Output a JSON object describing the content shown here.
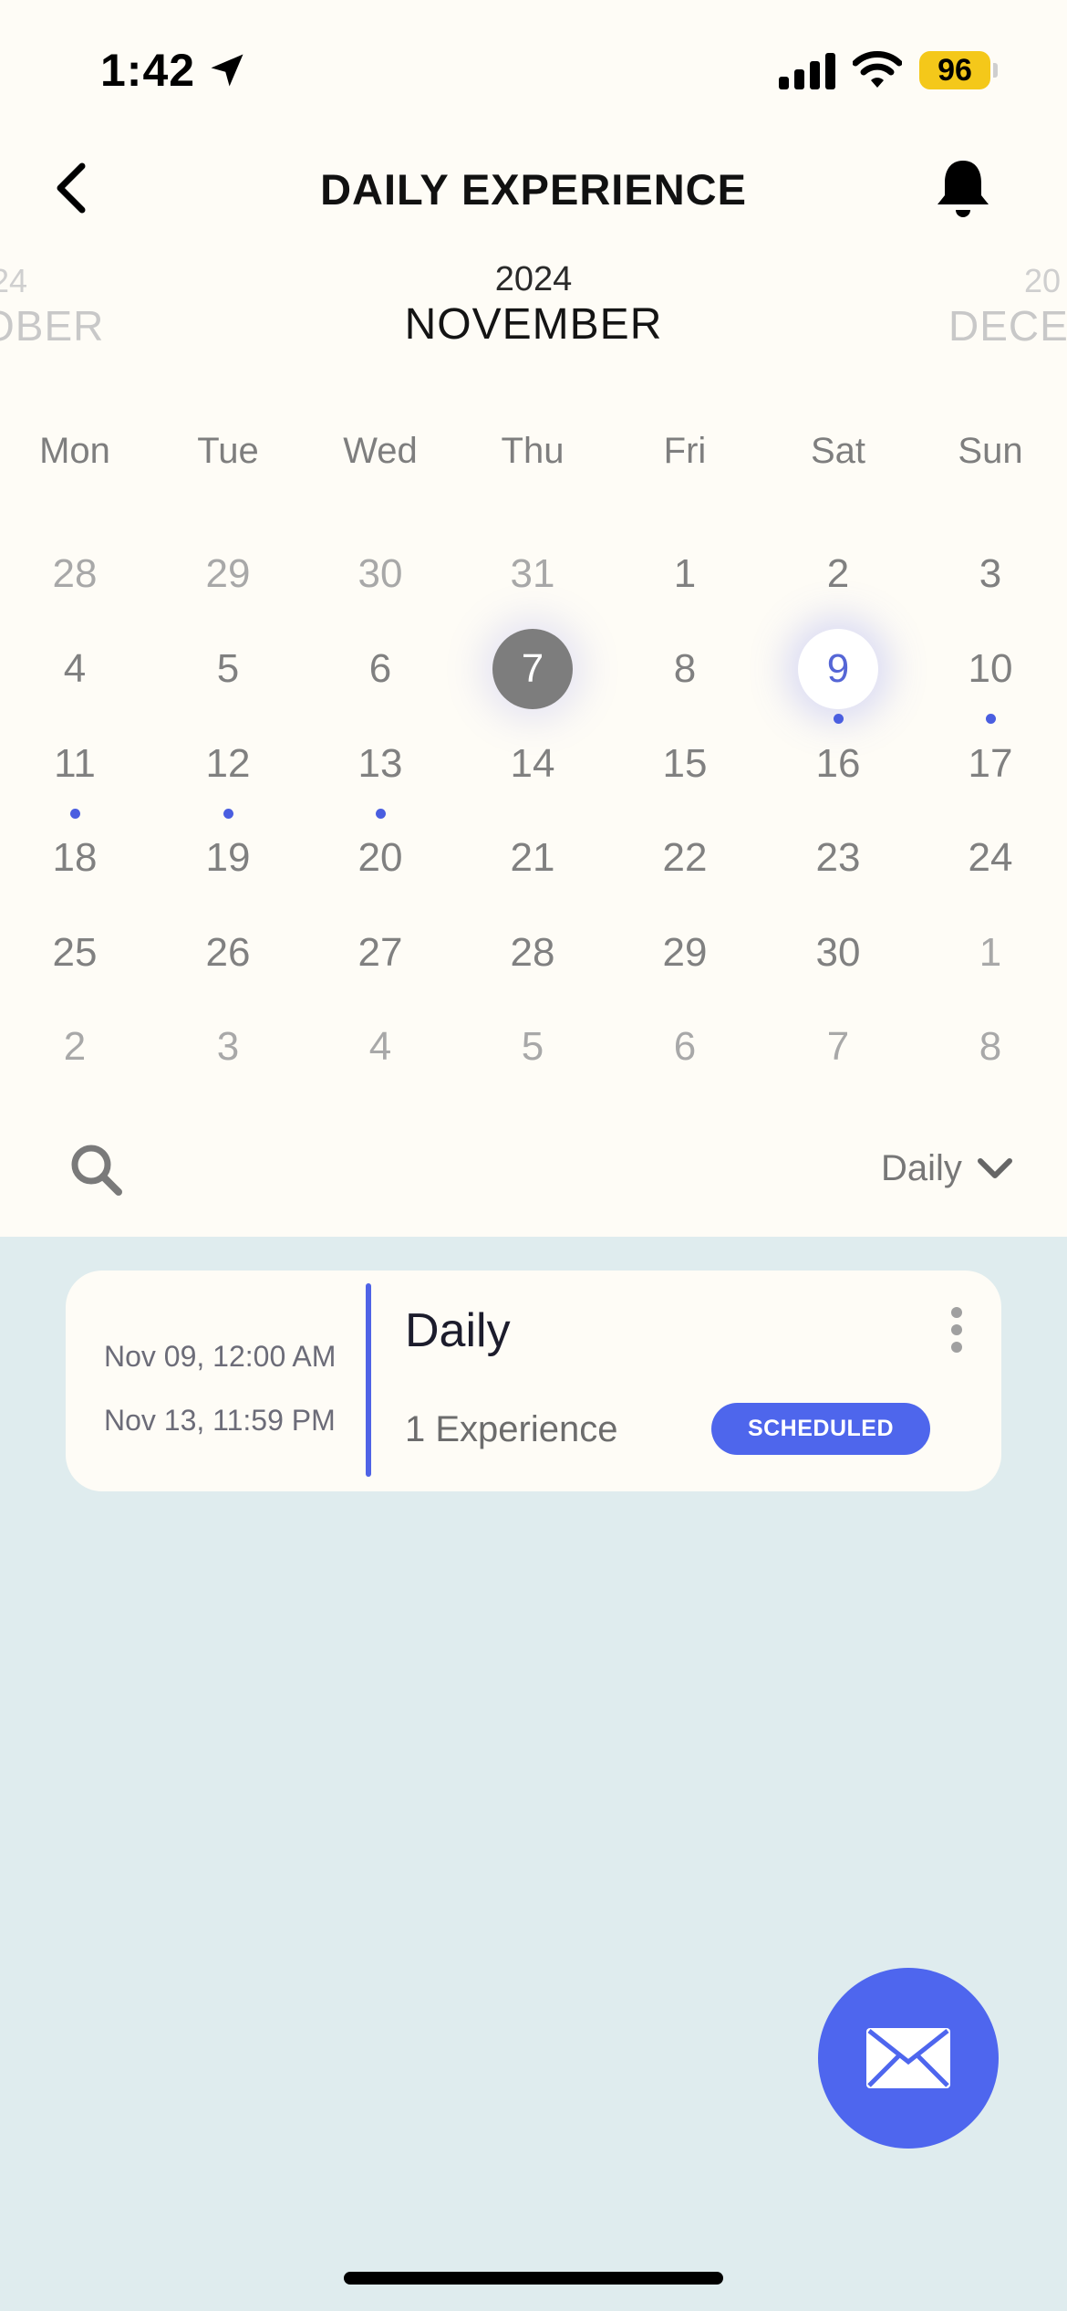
{
  "status_bar": {
    "time": "1:42",
    "battery": "96"
  },
  "header": {
    "title": "DAILY EXPERIENCE"
  },
  "calendar": {
    "year": "2024",
    "month": "NOVEMBER",
    "prev_year": "24",
    "prev_month": "OBER",
    "next_year": "20",
    "next_month": "DECE",
    "weekdays": [
      "Mon",
      "Tue",
      "Wed",
      "Thu",
      "Fri",
      "Sat",
      "Sun"
    ],
    "days": [
      [
        "28",
        "29",
        "30",
        "31",
        "1",
        "2",
        "3"
      ],
      [
        "4",
        "5",
        "6",
        "7",
        "8",
        "9",
        "10"
      ],
      [
        "11",
        "12",
        "13",
        "14",
        "15",
        "16",
        "17"
      ],
      [
        "18",
        "19",
        "20",
        "21",
        "22",
        "23",
        "24"
      ],
      [
        "25",
        "26",
        "27",
        "28",
        "29",
        "30",
        "1"
      ],
      [
        "2",
        "3",
        "4",
        "5",
        "6",
        "7",
        "8"
      ]
    ]
  },
  "toolbar": {
    "filter": "Daily"
  },
  "event": {
    "start": "Nov 09, 12:00 AM",
    "end": "Nov 13, 11:59 PM",
    "title": "Daily",
    "subtitle": "1 Experience",
    "status": "SCHEDULED"
  },
  "colors": {
    "accent": "#4e66ec",
    "today": "#7d7d7d",
    "background": "#dfecee",
    "surface": "#fefcf6"
  }
}
